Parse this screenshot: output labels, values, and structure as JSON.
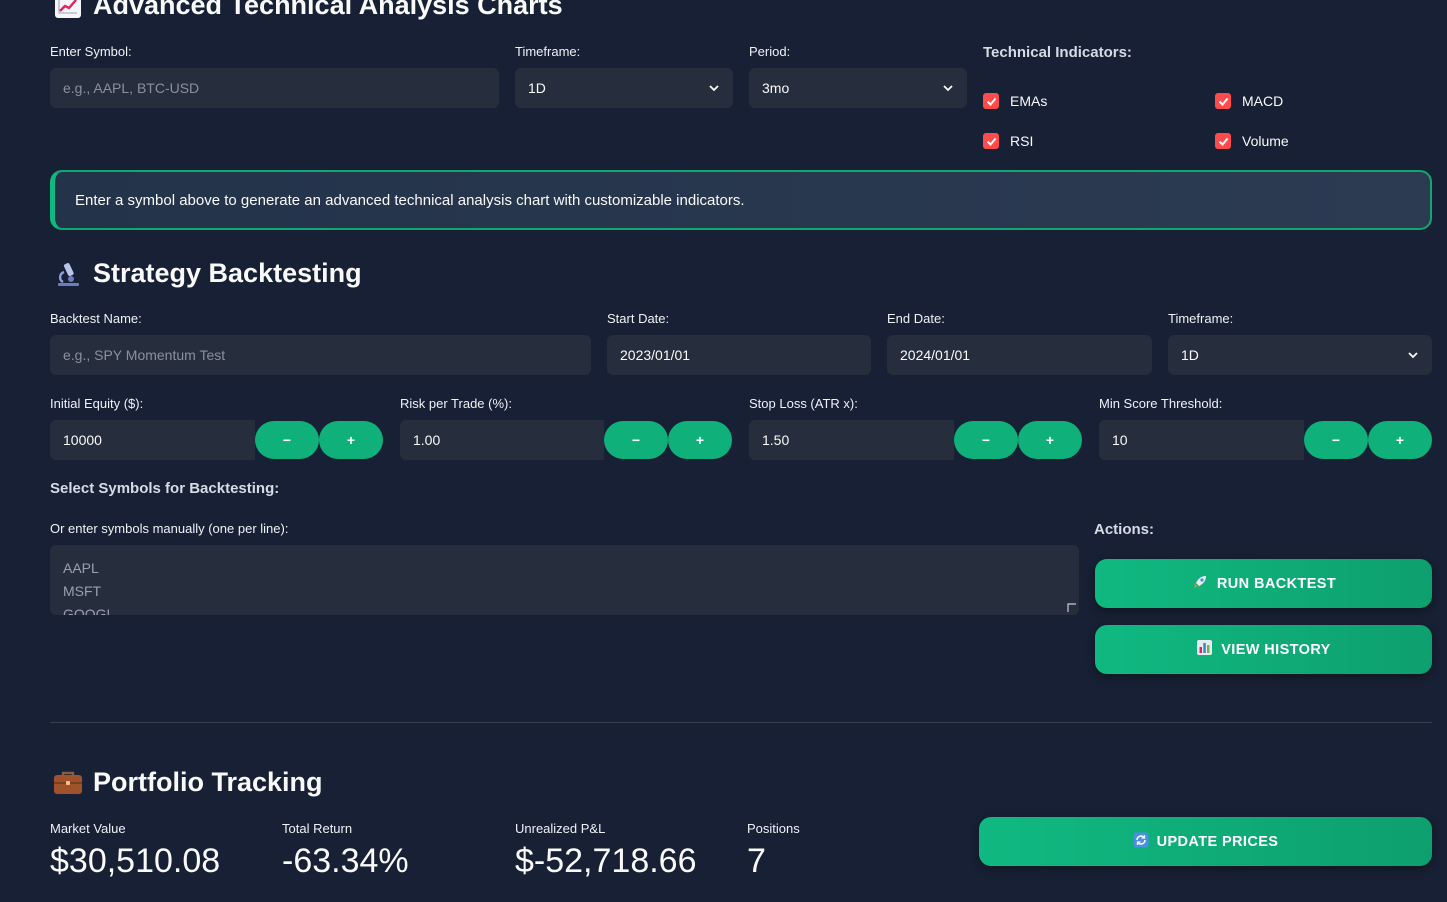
{
  "chart_section": {
    "title": "Advanced Technical Analysis Charts",
    "icon": "chart-increasing-icon",
    "symbol": {
      "label": "Enter Symbol:",
      "placeholder": "e.g., AAPL, BTC-USD"
    },
    "timeframe": {
      "label": "Timeframe:",
      "value": "1D"
    },
    "period": {
      "label": "Period:",
      "value": "3mo"
    },
    "indicators": {
      "label": "Technical Indicators:",
      "items": [
        {
          "label": "EMAs",
          "checked": true
        },
        {
          "label": "MACD",
          "checked": true
        },
        {
          "label": "RSI",
          "checked": true
        },
        {
          "label": "Volume",
          "checked": true
        }
      ]
    },
    "info": "Enter a symbol above to generate an advanced technical analysis chart with customizable indicators."
  },
  "backtest_section": {
    "title": "Strategy Backtesting",
    "icon": "microscope-icon",
    "name": {
      "label": "Backtest Name:",
      "placeholder": "e.g., SPY Momentum Test"
    },
    "start_date": {
      "label": "Start Date:",
      "value": "2023/01/01"
    },
    "end_date": {
      "label": "End Date:",
      "value": "2024/01/01"
    },
    "timeframe": {
      "label": "Timeframe:",
      "value": "1D"
    },
    "initial_equity": {
      "label": "Initial Equity ($):",
      "value": "10000"
    },
    "risk_per_trade": {
      "label": "Risk per Trade (%):",
      "value": "1.00"
    },
    "stop_loss": {
      "label": "Stop Loss (ATR x):",
      "value": "1.50"
    },
    "min_score": {
      "label": "Min Score Threshold:",
      "value": "10"
    },
    "stepper": {
      "minus": "−",
      "plus": "+"
    },
    "symbols_heading": "Select Symbols for Backtesting:",
    "manual_label": "Or enter symbols manually (one per line):",
    "manual_lines": [
      "AAPL",
      "MSFT",
      "GOOGL"
    ],
    "actions_label": "Actions:",
    "run_button": "RUN BACKTEST",
    "history_button": "VIEW HISTORY"
  },
  "portfolio_section": {
    "title": "Portfolio Tracking",
    "icon": "briefcase-icon",
    "metrics": [
      {
        "label": "Market Value",
        "value": "$30,510.08"
      },
      {
        "label": "Total Return",
        "value": "-63.34%"
      },
      {
        "label": "Unrealized P&L",
        "value": "$-52,718.66"
      },
      {
        "label": "Positions",
        "value": "7"
      }
    ],
    "update_button": "UPDATE PRICES"
  },
  "colors": {
    "background": "#172034",
    "accent": "#10b981",
    "checkbox": "#ff4b4b"
  }
}
